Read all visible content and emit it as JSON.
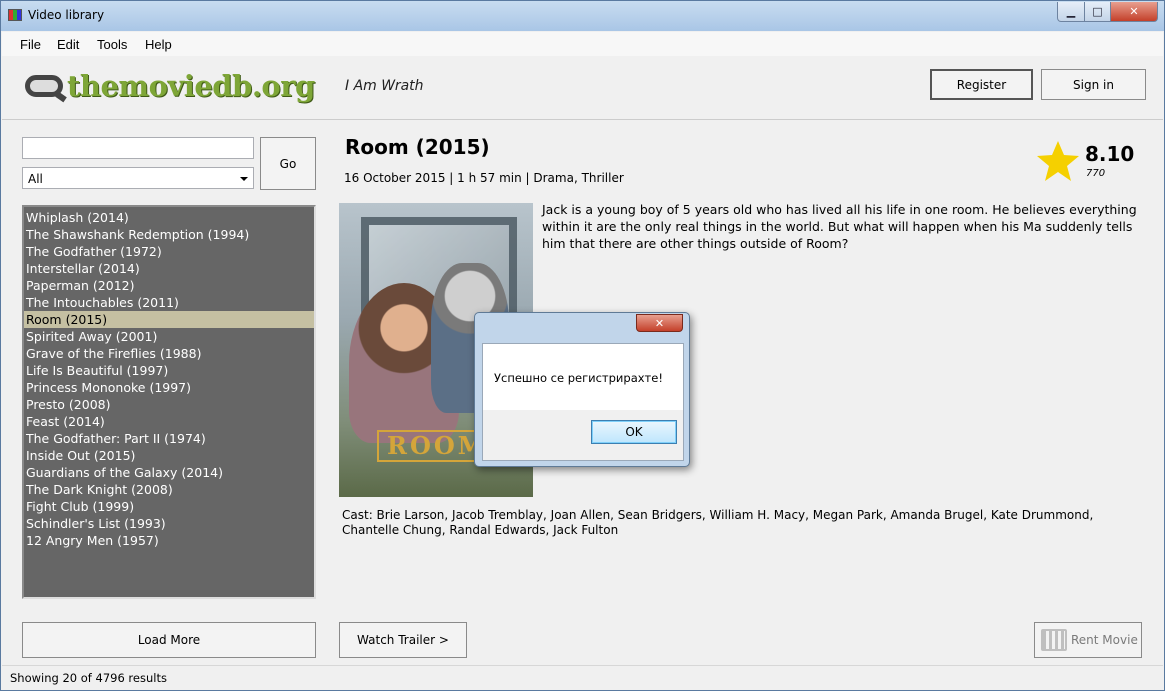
{
  "window": {
    "title": "Video library",
    "close_glyph": "✕",
    "min_glyph": "▁",
    "max_glyph": "□"
  },
  "menu": [
    "File",
    "Edit",
    "Tools",
    "Help"
  ],
  "header": {
    "logo_text": "themoviedb.org",
    "username": "I Am Wrath",
    "register_label": "Register",
    "signin_label": "Sign in"
  },
  "search": {
    "value": "",
    "go_label": "Go",
    "filter_value": "All"
  },
  "movies": [
    "Whiplash (2014)",
    "The Shawshank Redemption (1994)",
    "The Godfather (1972)",
    "Interstellar (2014)",
    "Paperman (2012)",
    "The Intouchables (2011)",
    "Room (2015)",
    "Spirited Away (2001)",
    "Grave of the Fireflies (1988)",
    "Life Is Beautiful (1997)",
    "Princess Mononoke (1997)",
    "Presto (2008)",
    "Feast (2014)",
    "The Godfather: Part II (1974)",
    "Inside Out (2015)",
    "Guardians of the Galaxy (2014)",
    "The Dark Knight (2008)",
    "Fight Club (1999)",
    "Schindler's List (1993)",
    "12 Angry Men (1957)"
  ],
  "selected_index": 6,
  "details": {
    "title": "Room (2015)",
    "meta": "16 October 2015  |  1 h 57 min  |  Drama, Thriller",
    "rating": "8.10",
    "votes": "770",
    "poster_text": "ROOM",
    "overview": "Jack is a young boy of 5 years old who has lived all his life in one room. He believes everything within it are the only real things in the world. But what will happen when his Ma suddenly tells him that there are other things outside of Room?",
    "cast": "Cast:  Brie Larson, Jacob Tremblay, Joan Allen, Sean Bridgers, William H. Macy, Megan Park, Amanda Brugel, Kate Drummond, Chantelle Chung, Randal Edwards, Jack Fulton"
  },
  "buttons": {
    "load_more": "Load More",
    "watch_trailer": "Watch Trailer >",
    "rent_movie": "Rent Movie"
  },
  "dialog": {
    "message": "Успешно се регистрирахте!",
    "ok_label": "OK",
    "close_glyph": "✕"
  },
  "status": {
    "text": "Showing 20 of 4796 results"
  },
  "colors": {
    "list_bg": "#666666",
    "selected_bg": "#c5c0a2",
    "logo_green": "#7ea637",
    "star": "#f5d000"
  }
}
